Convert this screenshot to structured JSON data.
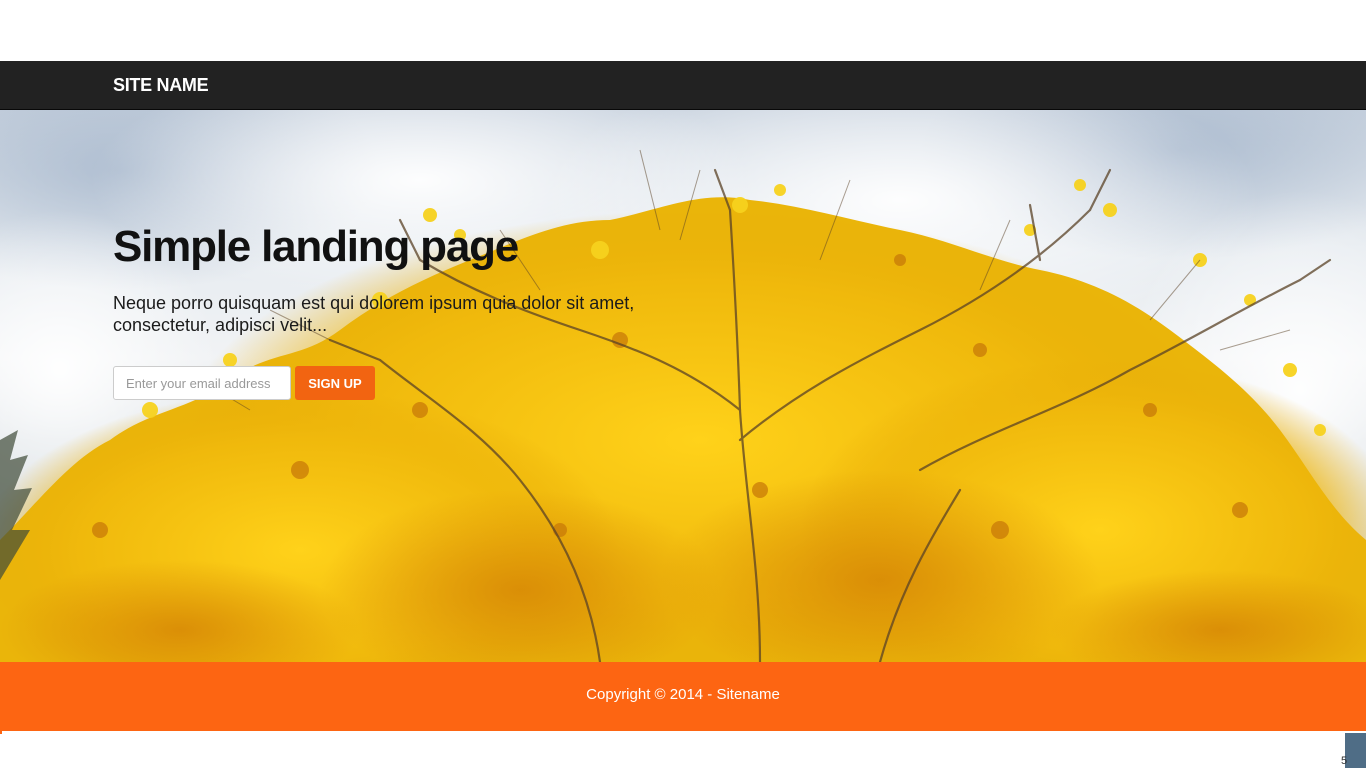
{
  "navbar": {
    "brand": "SITE NAME"
  },
  "hero": {
    "title": "Simple landing page",
    "subtitle": "Neque porro quisquam est qui dolorem ipsum quia dolor sit amet, consectetur, adipisci velit...",
    "background_description_icon": "autumn-tree-photo",
    "email_placeholder": "Enter your email address",
    "email_value": "",
    "signup_label": "SIGN UP"
  },
  "footer": {
    "copyright": "Copyright © 2014 - Sitename"
  },
  "widget": {
    "label": "5"
  },
  "colors": {
    "navbar": "#222222",
    "accent": "#fd6512",
    "button": "#f26411",
    "leaf_yellow": "#f2c410",
    "leaf_gold": "#e0a808"
  }
}
